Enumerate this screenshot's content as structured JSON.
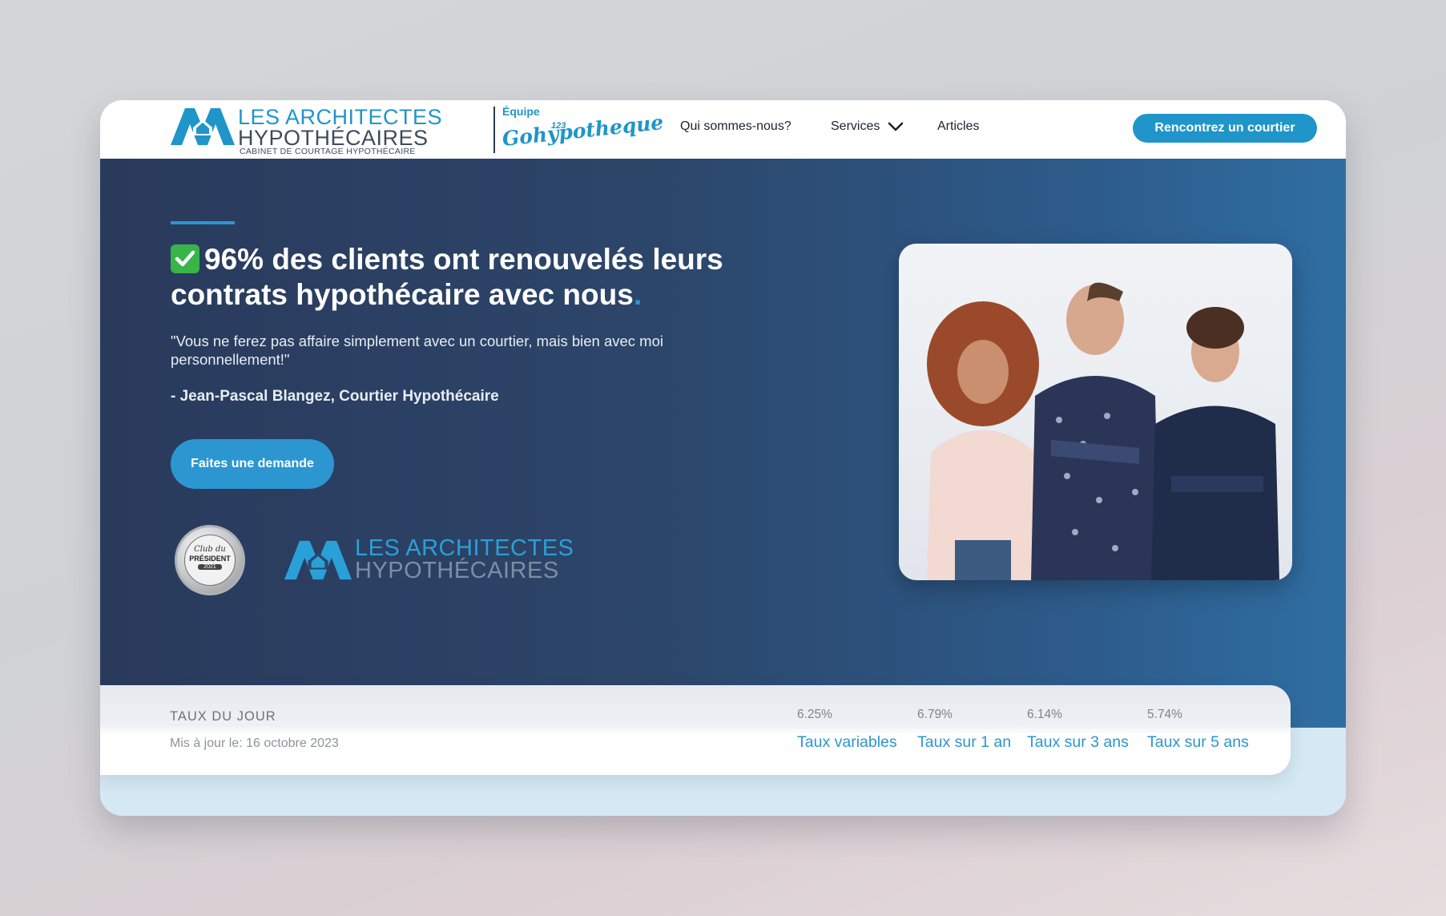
{
  "header": {
    "logo": {
      "line1": "LES ARCHITECTES",
      "line2": "HYPOTHÉCAIRES",
      "tagline": "CABINET DE COURTAGE HYPOTHÉCAIRE",
      "team_label": "Équipe",
      "team_name": "Gohypotheque",
      "team_number": "123"
    },
    "nav": {
      "about": "Qui sommes-nous?",
      "services": "Services",
      "articles": "Articles"
    },
    "cta": "Rencontrez un courtier"
  },
  "hero": {
    "title": "96% des clients ont renouvelés leurs contrats hypothécaire avec nous",
    "title_dot": ".",
    "quote": "\"Vous ne ferez pas affaire simplement avec un courtier, mais bien avec moi personnellement!\"",
    "author": "- Jean-Pascal Blangez, Courtier Hypothécaire",
    "cta": "Faites une demande",
    "badge": {
      "club": "Club du",
      "president": "PRÉSIDENT",
      "year": "2021"
    },
    "partner_logo": {
      "line1": "LES ARCHITECTES",
      "line2": "HYPOTHÉCAIRES"
    }
  },
  "rates": {
    "title": "TAUX DU JOUR",
    "updated": "Mis à jour le: 16 octobre 2023",
    "items": [
      {
        "value": "6.25%",
        "label": "Taux variables"
      },
      {
        "value": "6.79%",
        "label": "Taux sur 1 an"
      },
      {
        "value": "6.14%",
        "label": "Taux sur 3 ans"
      },
      {
        "value": "5.74%",
        "label": "Taux sur 5 ans"
      }
    ]
  },
  "colors": {
    "brand_blue": "#1f95c9",
    "hero_dark": "#2a3a5c",
    "check_green": "#38b449"
  }
}
